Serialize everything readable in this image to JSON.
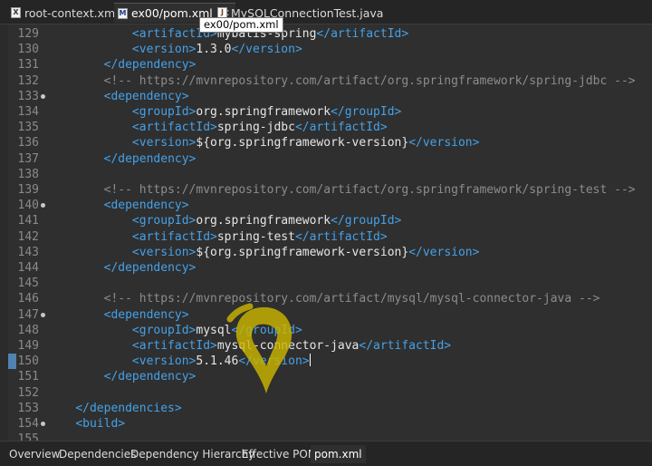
{
  "editor_tabs": [
    {
      "label": "root-context.xml",
      "icon": "xml-file-icon"
    },
    {
      "label": "ex00/pom.xml",
      "icon": "maven-pom-file-icon",
      "active": true
    },
    {
      "label": "MySQLConnectionTest.java",
      "icon": "java-file-icon"
    }
  ],
  "tooltip": "ex00/pom.xml",
  "code_lines": [
    {
      "n": "129",
      "t": "            <artifactId>mybatis-spring</artifactId>"
    },
    {
      "n": "130",
      "t": "            <version>1.3.0</version>"
    },
    {
      "n": "131",
      "t": "        </dependency>"
    },
    {
      "n": "132",
      "t": "        <!-- https://mvnrepository.com/artifact/org.springframework/spring-jdbc -->"
    },
    {
      "n": "133",
      "t": "        <dependency>",
      "fold": true
    },
    {
      "n": "134",
      "t": "            <groupId>org.springframework</groupId>"
    },
    {
      "n": "135",
      "t": "            <artifactId>spring-jdbc</artifactId>"
    },
    {
      "n": "136",
      "t": "            <version>${org.springframework-version}</version>"
    },
    {
      "n": "137",
      "t": "        </dependency>"
    },
    {
      "n": "138",
      "t": ""
    },
    {
      "n": "139",
      "t": "        <!-- https://mvnrepository.com/artifact/org.springframework/spring-test -->"
    },
    {
      "n": "140",
      "t": "        <dependency>",
      "fold": true
    },
    {
      "n": "141",
      "t": "            <groupId>org.springframework</groupId>"
    },
    {
      "n": "142",
      "t": "            <artifactId>spring-test</artifactId>"
    },
    {
      "n": "143",
      "t": "            <version>${org.springframework-version}</version>"
    },
    {
      "n": "144",
      "t": "        </dependency>"
    },
    {
      "n": "145",
      "t": ""
    },
    {
      "n": "146",
      "t": "        <!-- https://mvnrepository.com/artifact/mysql/mysql-connector-java -->"
    },
    {
      "n": "147",
      "t": "        <dependency>",
      "fold": true
    },
    {
      "n": "148",
      "t": "            <groupId>mysql</groupId>"
    },
    {
      "n": "149",
      "t": "            <artifactId>mysql-connector-java</artifactId>"
    },
    {
      "n": "150",
      "t": "            <version>5.1.46</version>",
      "current": true
    },
    {
      "n": "151",
      "t": "        </dependency>"
    },
    {
      "n": "152",
      "t": ""
    },
    {
      "n": "153",
      "t": "    </dependencies>"
    },
    {
      "n": "154",
      "t": "    <build>",
      "fold": true
    },
    {
      "n": "155",
      "t": ""
    }
  ],
  "bottom_tabs": [
    {
      "label": "Overview"
    },
    {
      "label": "Dependencies"
    },
    {
      "label": "Dependency Hierarchy"
    },
    {
      "label": "Effective POM"
    },
    {
      "label": "pom.xml",
      "active": true
    }
  ],
  "colors": {
    "tag": "#45a1e8",
    "text": "#e6e6e6",
    "comment": "#8c8c8c",
    "background": "#2f2f2f",
    "cursor_highlight": "#c9b400"
  }
}
